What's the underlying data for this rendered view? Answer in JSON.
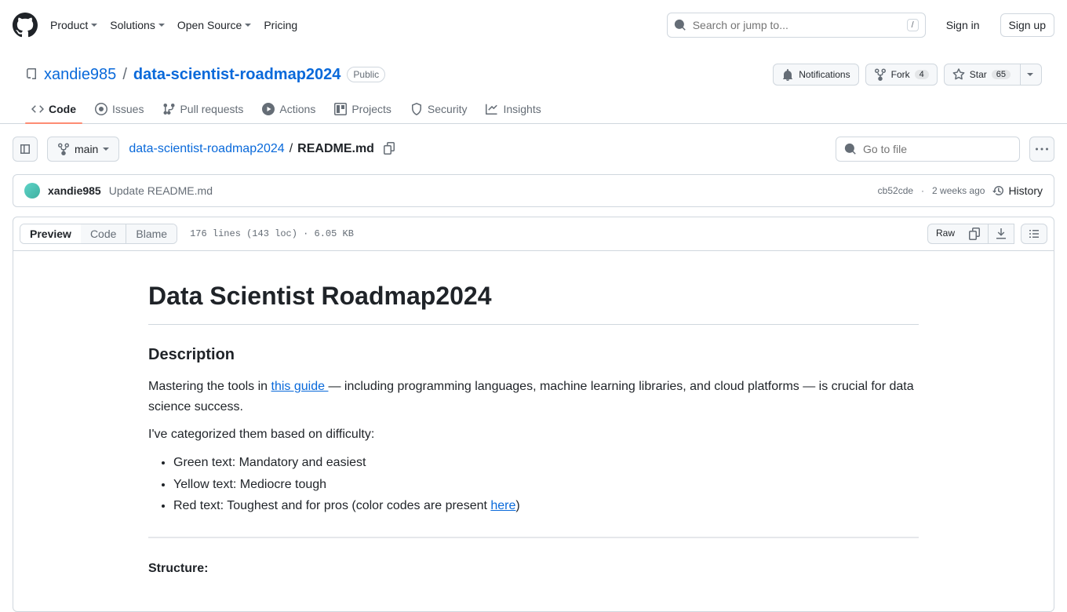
{
  "header": {
    "nav": [
      "Product",
      "Solutions",
      "Open Source",
      "Pricing"
    ],
    "search_placeholder": "Search or jump to...",
    "slash": "/",
    "signin": "Sign in",
    "signup": "Sign up"
  },
  "repo": {
    "owner": "xandie985",
    "name": "data-scientist-roadmap2024",
    "visibility": "Public",
    "notifications": "Notifications",
    "fork": "Fork",
    "fork_count": "4",
    "star": "Star",
    "star_count": "65"
  },
  "tabs": [
    "Code",
    "Issues",
    "Pull requests",
    "Actions",
    "Projects",
    "Security",
    "Insights"
  ],
  "toolbar": {
    "branch": "main",
    "crumb_repo": "data-scientist-roadmap2024",
    "crumb_file": "README.md",
    "goto_placeholder": "Go to file"
  },
  "commit": {
    "author": "xandie985",
    "message": "Update README.md",
    "sha": "cb52cde",
    "when": "2 weeks ago",
    "history": "History"
  },
  "view": {
    "seg": [
      "Preview",
      "Code",
      "Blame"
    ],
    "stats": "176 lines (143 loc) · 6.05 KB",
    "raw": "Raw"
  },
  "md": {
    "h1": "Data Scientist Roadmap2024",
    "h2_desc": "Description",
    "p1a": "Mastering the tools in ",
    "p1link": "this guide ",
    "p1b": "— including programming languages, machine learning libraries, and cloud platforms — is crucial for data science success.",
    "p2": "I've categorized them based on difficulty:",
    "li1": "Green text: Mandatory and easiest",
    "li2": "Yellow text: Mediocre tough",
    "li3a": "Red text: Toughest and for pros (color codes are present ",
    "li3link": "here",
    "li3b": ")",
    "structure": "Structure:"
  }
}
